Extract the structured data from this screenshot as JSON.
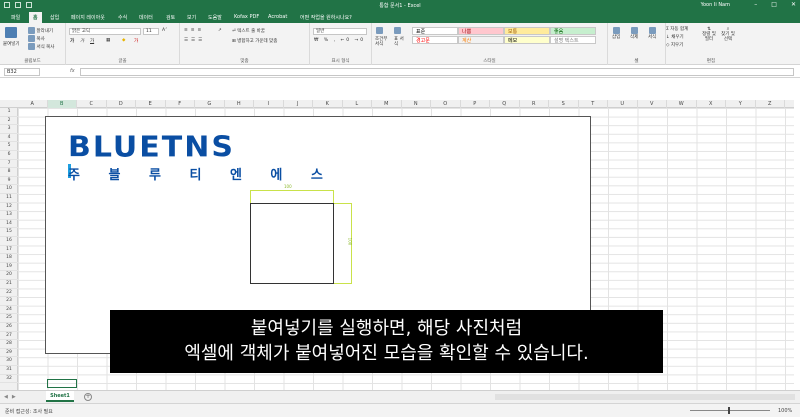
{
  "window": {
    "doc_title": "통합 문서1 - Excel",
    "user": "Yoon Ii Nam"
  },
  "tabs": [
    "파일",
    "홈",
    "삽입",
    "페이지 레이아웃",
    "수식",
    "데이터",
    "검토",
    "보기",
    "도움말",
    "Kofax PDF",
    "Acrobat",
    "어떤 작업을 원하시나요?"
  ],
  "ribbon": {
    "clipboard": {
      "paste": "붙여넣기",
      "cut": "잘라내기",
      "copy": "복사",
      "format_painter": "서식 복사",
      "label": "클립보드"
    },
    "font": {
      "name": "맑은 고딕",
      "size": "11",
      "label": "글꼴"
    },
    "alignment": {
      "wrap": "텍스트 줄 바꿈",
      "merge": "병합하고 가운데 맞춤",
      "label": "맞춤"
    },
    "number": {
      "format": "일반",
      "label": "표시 형식"
    },
    "styles": {
      "conditional": "조건부 서식",
      "table": "표 서식",
      "cells": [
        {
          "text": "표준",
          "bg": "#ffffff",
          "color": "#000000"
        },
        {
          "text": "나쁨",
          "bg": "#ffc7ce",
          "color": "#9c0006"
        },
        {
          "text": "보통",
          "bg": "#ffeb9c",
          "color": "#9c5700"
        },
        {
          "text": "좋음",
          "bg": "#c6efce",
          "color": "#006100"
        },
        {
          "text": "경고문",
          "bg": "#ffffff",
          "color": "#ff0000"
        },
        {
          "text": "계산",
          "bg": "#f2f2f2",
          "color": "#fa7d00"
        },
        {
          "text": "메모",
          "bg": "#ffffcc",
          "color": "#000000"
        },
        {
          "text": "설명 텍스트",
          "bg": "#ffffff",
          "color": "#7f7f7f"
        }
      ],
      "label": "스타일"
    },
    "cells": {
      "insert": "삽입",
      "delete": "삭제",
      "format": "서식",
      "label": "셀"
    },
    "editing": {
      "autosum": "자동 합계",
      "fill": "채우기",
      "clear": "지우기",
      "sort": "정렬 및 필터",
      "find": "찾기 및 선택",
      "label": "편집"
    }
  },
  "formula_bar": {
    "name_box": "B32",
    "fx": "fx",
    "value": ""
  },
  "columns": [
    "A",
    "B",
    "C",
    "D",
    "E",
    "F",
    "G",
    "H",
    "I",
    "J",
    "K",
    "L",
    "M",
    "N",
    "O",
    "P",
    "Q",
    "R",
    "S",
    "T",
    "U",
    "V",
    "W",
    "X",
    "Y",
    "Z"
  ],
  "rows": [
    "1",
    "2",
    "3",
    "4",
    "5",
    "6",
    "7",
    "8",
    "9",
    "10",
    "11",
    "12",
    "13",
    "14",
    "15",
    "16",
    "17",
    "18",
    "19",
    "20",
    "21",
    "22",
    "23",
    "24",
    "25",
    "26",
    "27",
    "28",
    "29",
    "30",
    "31",
    "32"
  ],
  "selected_col": "B",
  "drawing": {
    "logo": "BLUETNS",
    "logo_sub": "주 블 루 티 엔 에 스",
    "dim_width": "100",
    "dim_height": "100"
  },
  "caption": {
    "line1": "붙여넣기를 실행하면, 해당 사진처럼",
    "line2": "엑셀에 객체가 붙여넣어진 모습을 확인할 수 있습니다."
  },
  "sheet_tab": "Sheet1",
  "status": {
    "left": "준비  접근성: 조사 필요",
    "zoom": "100%"
  }
}
